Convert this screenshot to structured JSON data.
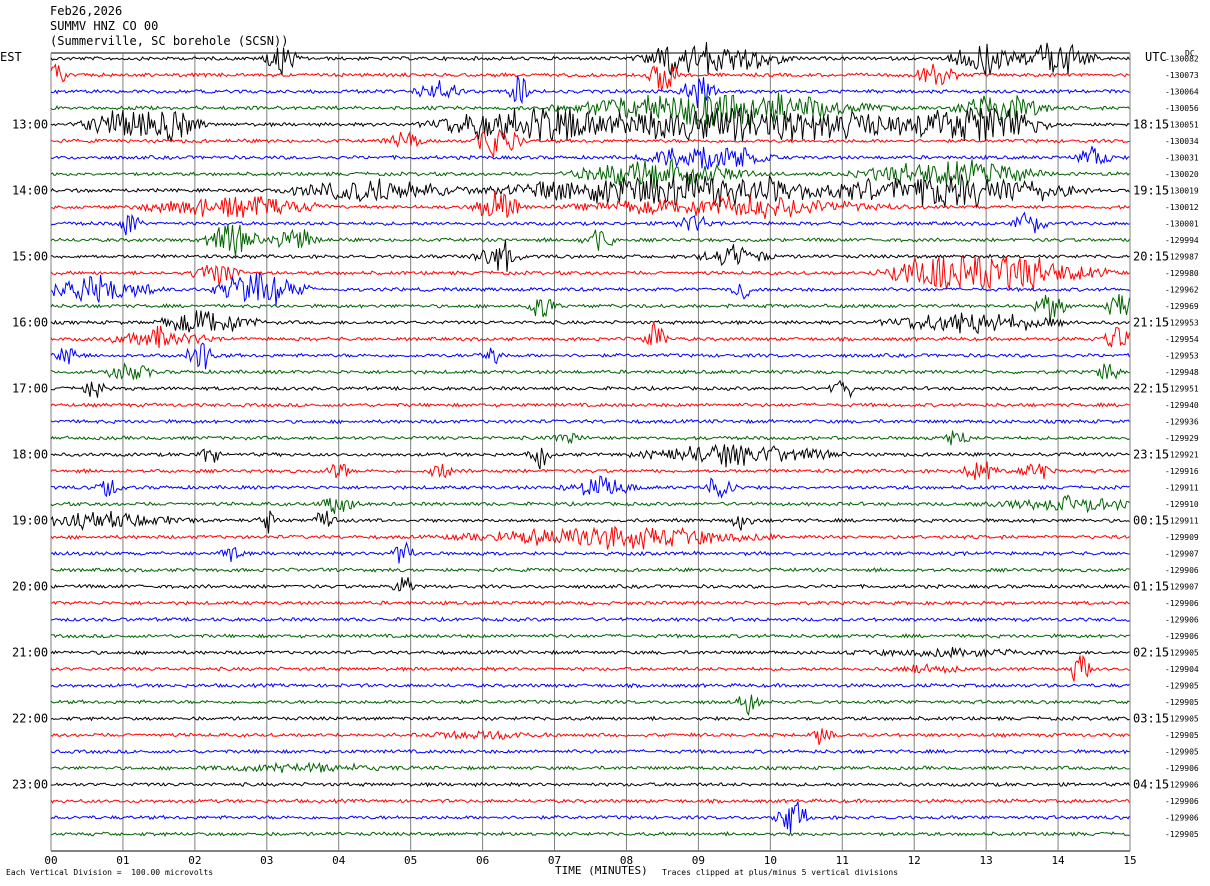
{
  "header": {
    "date": "Feb26,2026",
    "station": "SUMMV HNZ CO 00",
    "location": "(Summerville, SC borehole (SCSN))"
  },
  "left_timezone": "EST",
  "right_timezone": "UTC",
  "unit_mark": "DC",
  "footer": {
    "scale_note": "Each Vertical Division =  100.00 microvolts",
    "clip_note": "Traces clipped at plus/minus 5 vertical divisions"
  },
  "colors": {
    "trace_cycle": [
      "#000000",
      "#ff0000",
      "#0000ff",
      "#006400"
    ],
    "grid": "#7f7f7f"
  },
  "chart_data": {
    "type": "line",
    "title": "",
    "xlabel": "TIME (MINUTES)",
    "ylabel": "",
    "xlim": [
      0,
      15
    ],
    "x_ticks": [
      "00",
      "01",
      "02",
      "03",
      "04",
      "05",
      "06",
      "07",
      "08",
      "09",
      "10",
      "11",
      "12",
      "13",
      "14",
      "15"
    ],
    "left_hour_labels": [
      "13:00",
      "14:00",
      "15:00",
      "16:00",
      "17:00",
      "18:00",
      "19:00",
      "20:00",
      "21:00",
      "22:00",
      "23:00"
    ],
    "right_hour_labels": [
      "18:15",
      "19:15",
      "20:15",
      "21:15",
      "22:15",
      "23:15",
      "00:15",
      "01:15",
      "02:15",
      "03:15",
      "04:15"
    ],
    "trace_dc_offsets": [
      "-130082",
      "-130073",
      "-130064",
      "-130056",
      "-130051",
      "-130034",
      "-130031",
      "-130020",
      "-130019",
      "-130012",
      "-130001",
      "-129994",
      "-129987",
      "-129980",
      "-129962",
      "-129969",
      "-129953",
      "-129954",
      "-129953",
      "-129948",
      "-129951",
      "-129940",
      "-129936",
      "-129929",
      "-129921",
      "-129916",
      "-129911",
      "-129910",
      "-129911",
      "-129909",
      "-129907",
      "-129906",
      "-129907",
      "-129906",
      "-129906",
      "-129906",
      "-129905",
      "-129904",
      "-129905",
      "-129905",
      "-129905",
      "-129905",
      "-129905",
      "-129906",
      "-129906",
      "-129906",
      "-129906",
      "-129905"
    ],
    "events": [
      {
        "trace": 0,
        "t": 3.2,
        "amp": 4,
        "w": 0.3
      },
      {
        "trace": 0,
        "t": 8.55,
        "amp": 5,
        "w": 0.2
      },
      {
        "trace": 0,
        "t": 9.2,
        "amp": 5,
        "w": 1.2
      },
      {
        "trace": 0,
        "t": 13.0,
        "amp": 5,
        "w": 0.6
      },
      {
        "trace": 0,
        "t": 14.0,
        "amp": 5,
        "w": 0.6
      },
      {
        "trace": 1,
        "t": 0.1,
        "amp": 3,
        "w": 0.2
      },
      {
        "trace": 1,
        "t": 8.5,
        "amp": 5,
        "w": 0.3
      },
      {
        "trace": 1,
        "t": 12.3,
        "amp": 3,
        "w": 0.4
      },
      {
        "trace": 2,
        "t": 5.4,
        "amp": 3,
        "w": 0.4
      },
      {
        "trace": 2,
        "t": 6.5,
        "amp": 4,
        "w": 0.2
      },
      {
        "trace": 2,
        "t": 9.0,
        "amp": 4,
        "w": 0.3
      },
      {
        "trace": 3,
        "t": 9.3,
        "amp": 5,
        "w": 2.5
      },
      {
        "trace": 3,
        "t": 13.2,
        "amp": 4,
        "w": 0.8
      },
      {
        "trace": 4,
        "t": 1.0,
        "amp": 4,
        "w": 0.8
      },
      {
        "trace": 4,
        "t": 1.7,
        "amp": 5,
        "w": 0.5
      },
      {
        "trace": 4,
        "t": 6.5,
        "amp": 5,
        "w": 1.5
      },
      {
        "trace": 4,
        "t": 9.8,
        "amp": 5,
        "w": 4.0
      },
      {
        "trace": 4,
        "t": 13.0,
        "amp": 5,
        "w": 1.0
      },
      {
        "trace": 5,
        "t": 6.2,
        "amp": 5,
        "w": 0.4
      },
      {
        "trace": 5,
        "t": 4.9,
        "amp": 3,
        "w": 0.3
      },
      {
        "trace": 6,
        "t": 9.1,
        "amp": 5,
        "w": 1.0
      },
      {
        "trace": 6,
        "t": 14.5,
        "amp": 3,
        "w": 0.3
      },
      {
        "trace": 7,
        "t": 8.5,
        "amp": 4,
        "w": 1.5
      },
      {
        "trace": 7,
        "t": 12.5,
        "amp": 4,
        "w": 1.5
      },
      {
        "trace": 8,
        "t": 4.5,
        "amp": 3,
        "w": 1.5
      },
      {
        "trace": 8,
        "t": 8.7,
        "amp": 5,
        "w": 3.0
      },
      {
        "trace": 8,
        "t": 12.6,
        "amp": 5,
        "w": 2.0
      },
      {
        "trace": 9,
        "t": 2.5,
        "amp": 3,
        "w": 1.5
      },
      {
        "trace": 9,
        "t": 6.2,
        "amp": 5,
        "w": 0.4
      },
      {
        "trace": 9,
        "t": 9.5,
        "amp": 3,
        "w": 2.5
      },
      {
        "trace": 10,
        "t": 1.1,
        "amp": 4,
        "w": 0.2
      },
      {
        "trace": 10,
        "t": 8.9,
        "amp": 3,
        "w": 0.3
      },
      {
        "trace": 10,
        "t": 13.6,
        "amp": 4,
        "w": 0.3
      },
      {
        "trace": 11,
        "t": 2.5,
        "amp": 4,
        "w": 0.5
      },
      {
        "trace": 11,
        "t": 3.4,
        "amp": 3,
        "w": 0.4
      },
      {
        "trace": 11,
        "t": 7.6,
        "amp": 3,
        "w": 0.3
      },
      {
        "trace": 12,
        "t": 6.2,
        "amp": 5,
        "w": 0.4
      },
      {
        "trace": 12,
        "t": 9.5,
        "amp": 3,
        "w": 0.6
      },
      {
        "trace": 13,
        "t": 2.3,
        "amp": 4,
        "w": 0.4
      },
      {
        "trace": 13,
        "t": 12.2,
        "amp": 4,
        "w": 0.8
      },
      {
        "trace": 13,
        "t": 13.3,
        "amp": 5,
        "w": 1.6
      },
      {
        "trace": 14,
        "t": 0.6,
        "amp": 4,
        "w": 1.0
      },
      {
        "trace": 14,
        "t": 2.9,
        "amp": 5,
        "w": 0.8
      },
      {
        "trace": 14,
        "t": 9.6,
        "amp": 3,
        "w": 0.2
      },
      {
        "trace": 15,
        "t": 6.8,
        "amp": 3,
        "w": 0.3
      },
      {
        "trace": 15,
        "t": 13.9,
        "amp": 4,
        "w": 0.3
      },
      {
        "trace": 15,
        "t": 14.9,
        "amp": 4,
        "w": 0.3
      },
      {
        "trace": 16,
        "t": 2.2,
        "amp": 4,
        "w": 0.8
      },
      {
        "trace": 16,
        "t": 12.8,
        "amp": 3,
        "w": 1.5
      },
      {
        "trace": 17,
        "t": 1.5,
        "amp": 3,
        "w": 0.8
      },
      {
        "trace": 17,
        "t": 8.4,
        "amp": 4,
        "w": 0.2
      },
      {
        "trace": 17,
        "t": 14.8,
        "amp": 3,
        "w": 0.3
      },
      {
        "trace": 18,
        "t": 0.2,
        "amp": 4,
        "w": 0.2
      },
      {
        "trace": 18,
        "t": 2.1,
        "amp": 4,
        "w": 0.3
      },
      {
        "trace": 18,
        "t": 6.1,
        "amp": 4,
        "w": 0.2
      },
      {
        "trace": 19,
        "t": 1.1,
        "amp": 3,
        "w": 0.4
      },
      {
        "trace": 19,
        "t": 14.7,
        "amp": 3,
        "w": 0.2
      },
      {
        "trace": 20,
        "t": 0.6,
        "amp": 3,
        "w": 0.2
      },
      {
        "trace": 20,
        "t": 11.0,
        "amp": 4,
        "w": 0.2
      },
      {
        "trace": 23,
        "t": 7.2,
        "amp": 2,
        "w": 0.3
      },
      {
        "trace": 23,
        "t": 12.6,
        "amp": 3,
        "w": 0.2
      },
      {
        "trace": 24,
        "t": 2.2,
        "amp": 3,
        "w": 0.2
      },
      {
        "trace": 24,
        "t": 6.8,
        "amp": 3,
        "w": 0.2
      },
      {
        "trace": 24,
        "t": 9.5,
        "amp": 3,
        "w": 1.6
      },
      {
        "trace": 25,
        "t": 4.0,
        "amp": 3,
        "w": 0.2
      },
      {
        "trace": 25,
        "t": 5.4,
        "amp": 3,
        "w": 0.2
      },
      {
        "trace": 25,
        "t": 12.9,
        "amp": 4,
        "w": 0.3
      },
      {
        "trace": 25,
        "t": 13.7,
        "amp": 3,
        "w": 0.3
      },
      {
        "trace": 26,
        "t": 0.8,
        "amp": 3,
        "w": 0.2
      },
      {
        "trace": 26,
        "t": 7.6,
        "amp": 3,
        "w": 0.6
      },
      {
        "trace": 26,
        "t": 9.3,
        "amp": 3,
        "w": 0.3
      },
      {
        "trace": 27,
        "t": 4.0,
        "amp": 3,
        "w": 0.3
      },
      {
        "trace": 27,
        "t": 14.3,
        "amp": 2,
        "w": 1.5
      },
      {
        "trace": 28,
        "t": 0.7,
        "amp": 2,
        "w": 1.4
      },
      {
        "trace": 28,
        "t": 3.0,
        "amp": 3,
        "w": 0.2
      },
      {
        "trace": 28,
        "t": 3.8,
        "amp": 3,
        "w": 0.2
      },
      {
        "trace": 28,
        "t": 9.6,
        "amp": 3,
        "w": 0.2
      },
      {
        "trace": 29,
        "t": 7.8,
        "amp": 3,
        "w": 2.5
      },
      {
        "trace": 30,
        "t": 2.5,
        "amp": 3,
        "w": 0.2
      },
      {
        "trace": 30,
        "t": 4.9,
        "amp": 4,
        "w": 0.2
      },
      {
        "trace": 32,
        "t": 4.9,
        "amp": 3,
        "w": 0.2
      },
      {
        "trace": 36,
        "t": 12.5,
        "amp": 1,
        "w": 1.5
      },
      {
        "trace": 37,
        "t": 12.2,
        "amp": 1,
        "w": 0.6
      },
      {
        "trace": 37,
        "t": 14.3,
        "amp": 4,
        "w": 0.2
      },
      {
        "trace": 39,
        "t": 9.7,
        "amp": 3,
        "w": 0.2
      },
      {
        "trace": 41,
        "t": 6.0,
        "amp": 1,
        "w": 1.0
      },
      {
        "trace": 41,
        "t": 10.7,
        "amp": 3,
        "w": 0.2
      },
      {
        "trace": 43,
        "t": 3.5,
        "amp": 1,
        "w": 1.5
      },
      {
        "trace": 46,
        "t": 10.3,
        "amp": 5,
        "w": 0.3
      }
    ]
  }
}
